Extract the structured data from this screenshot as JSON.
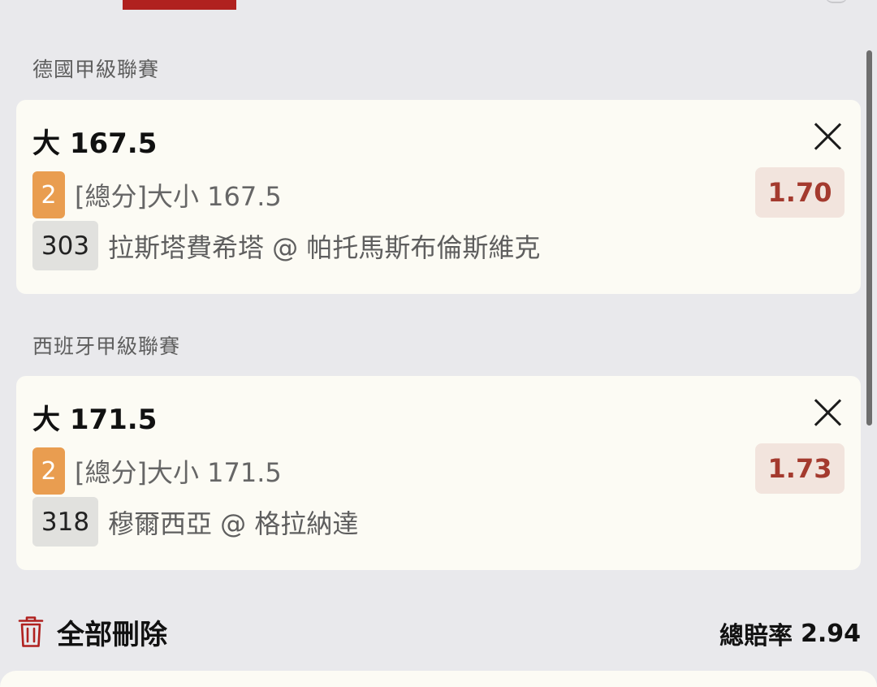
{
  "bets": [
    {
      "league": "德國甲級聯賽",
      "headline": "大 167.5",
      "parlay_count": "2",
      "bet_type": "[總分]大小 167.5",
      "odds": "1.70",
      "match_code": "303",
      "match_name": "拉斯塔費希塔 @ 帕托馬斯布倫斯維克"
    },
    {
      "league": "西班牙甲級聯賽",
      "headline": "大 171.5",
      "parlay_count": "2",
      "bet_type": "[總分]大小 171.5",
      "odds": "1.73",
      "match_code": "318",
      "match_name": "穆爾西亞 @ 格拉納達"
    }
  ],
  "footer": {
    "clear_all_label": "全部刪除",
    "total_odds_label": "總賠率",
    "total_odds_value": "2.94"
  },
  "icons": {
    "close": "close-icon",
    "trash": "trash-icon"
  },
  "colors": {
    "accent": "#b0211f",
    "odds_text": "#a43a2e",
    "odds_bg": "#f2e4dd",
    "badge": "#e99d50",
    "card_bg": "#fcfbf4",
    "page_bg": "#e9e9ec"
  }
}
